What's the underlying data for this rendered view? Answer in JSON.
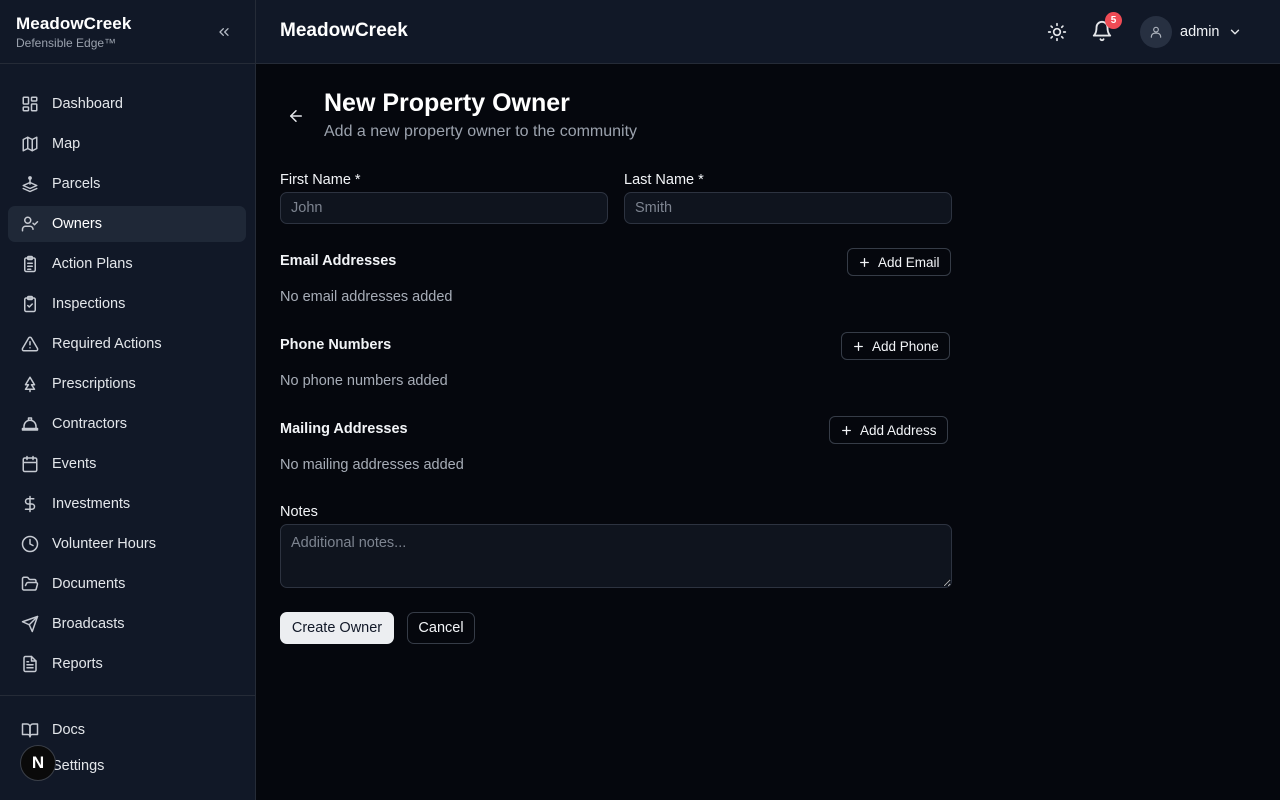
{
  "brand": {
    "name": "MeadowCreek",
    "tagline": "Defensible Edge™"
  },
  "sidebar": {
    "items": [
      {
        "label": "Dashboard",
        "icon": "dashboard-icon"
      },
      {
        "label": "Map",
        "icon": "map-icon"
      },
      {
        "label": "Parcels",
        "icon": "parcels-icon"
      },
      {
        "label": "Owners",
        "icon": "user-check-icon",
        "active": true
      },
      {
        "label": "Action Plans",
        "icon": "clipboard-list-icon"
      },
      {
        "label": "Inspections",
        "icon": "clipboard-check-icon"
      },
      {
        "label": "Required Actions",
        "icon": "alert-triangle-icon"
      },
      {
        "label": "Prescriptions",
        "icon": "tree-icon"
      },
      {
        "label": "Contractors",
        "icon": "hard-hat-icon"
      },
      {
        "label": "Events",
        "icon": "calendar-icon"
      },
      {
        "label": "Investments",
        "icon": "dollar-icon"
      },
      {
        "label": "Volunteer Hours",
        "icon": "clock-icon"
      },
      {
        "label": "Documents",
        "icon": "folder-open-icon"
      },
      {
        "label": "Broadcasts",
        "icon": "send-icon"
      },
      {
        "label": "Reports",
        "icon": "file-text-icon"
      }
    ],
    "bottom_items": [
      {
        "label": "Docs",
        "icon": "book-icon"
      },
      {
        "label": "Settings",
        "icon": "settings-icon"
      }
    ],
    "overlay_badge": "N"
  },
  "header": {
    "title": "MeadowCreek",
    "notification_count": "5",
    "user_name": "admin"
  },
  "page": {
    "title": "New Property Owner",
    "subtitle": "Add a new property owner to the community"
  },
  "form": {
    "first_name": {
      "label": "First Name *",
      "placeholder": "John",
      "value": ""
    },
    "last_name": {
      "label": "Last Name *",
      "placeholder": "Smith",
      "value": ""
    },
    "emails": {
      "label": "Email Addresses",
      "add_label": "Add Email",
      "empty": "No email addresses added"
    },
    "phones": {
      "label": "Phone Numbers",
      "add_label": "Add Phone",
      "empty": "No phone numbers added"
    },
    "addresses": {
      "label": "Mailing Addresses",
      "add_label": "Add Address",
      "empty": "No mailing addresses added"
    },
    "notes": {
      "label": "Notes",
      "placeholder": "Additional notes..."
    },
    "submit_label": "Create Owner",
    "cancel_label": "Cancel"
  },
  "colors": {
    "background": "#05070d",
    "panel": "#111827",
    "active_nav": "#1f2837",
    "badge": "#ef4b55",
    "primary_button": "#eceef1"
  }
}
